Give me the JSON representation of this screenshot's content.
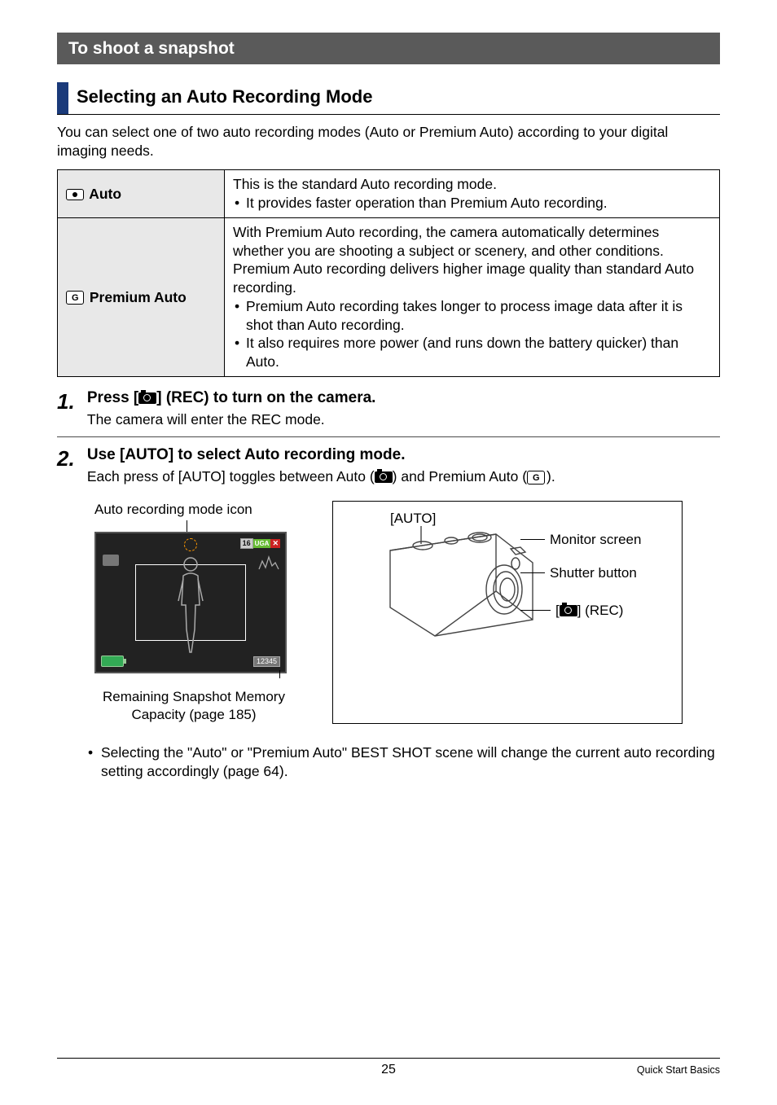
{
  "section_title": "To shoot a snapshot",
  "subsection_title": "Selecting an Auto Recording Mode",
  "intro": "You can select one of two auto recording modes (Auto or Premium Auto) according to your digital imaging needs.",
  "table": {
    "auto": {
      "label": " Auto",
      "desc": "This is the standard Auto recording mode.",
      "bullets": [
        "It provides faster operation than Premium Auto recording."
      ]
    },
    "premium": {
      "label": " Premium Auto",
      "desc": "With Premium Auto recording, the camera automatically determines whether you are shooting a subject or scenery, and other conditions. Premium Auto recording delivers higher image quality than standard Auto recording.",
      "bullets": [
        "Premium Auto recording takes longer to process image data after it is shot than Auto recording.",
        "It also requires more power (and runs down the battery quicker) than Auto."
      ]
    }
  },
  "steps": {
    "s1": {
      "num": "1.",
      "title_pre": "Press [",
      "title_post": "] (REC) to turn on the camera.",
      "desc": "The camera will enter the REC mode."
    },
    "s2": {
      "num": "2.",
      "title": "Use [AUTO] to select Auto recording mode.",
      "desc_pre": "Each press of [AUTO] toggles between Auto (",
      "desc_mid": ") and Premium Auto (",
      "desc_post": ")."
    }
  },
  "diagrams": {
    "left": {
      "caption_top": "Auto recording mode icon",
      "badge_num": "16",
      "badge_text": "UGA",
      "bottom_right": "12345",
      "caption_bottom_l1": "Remaining Snapshot Memory",
      "caption_bottom_l2": "Capacity (page 185)"
    },
    "right": {
      "auto_label": "[AUTO]",
      "monitor": "Monitor screen",
      "shutter": "Shutter button",
      "rec_pre": "[",
      "rec_post": "] (REC)"
    }
  },
  "note": "Selecting the \"Auto\" or \"Premium Auto\" BEST SHOT scene will change the current auto recording setting accordingly (page 64).",
  "footer": {
    "page": "25",
    "chapter": "Quick Start Basics"
  }
}
